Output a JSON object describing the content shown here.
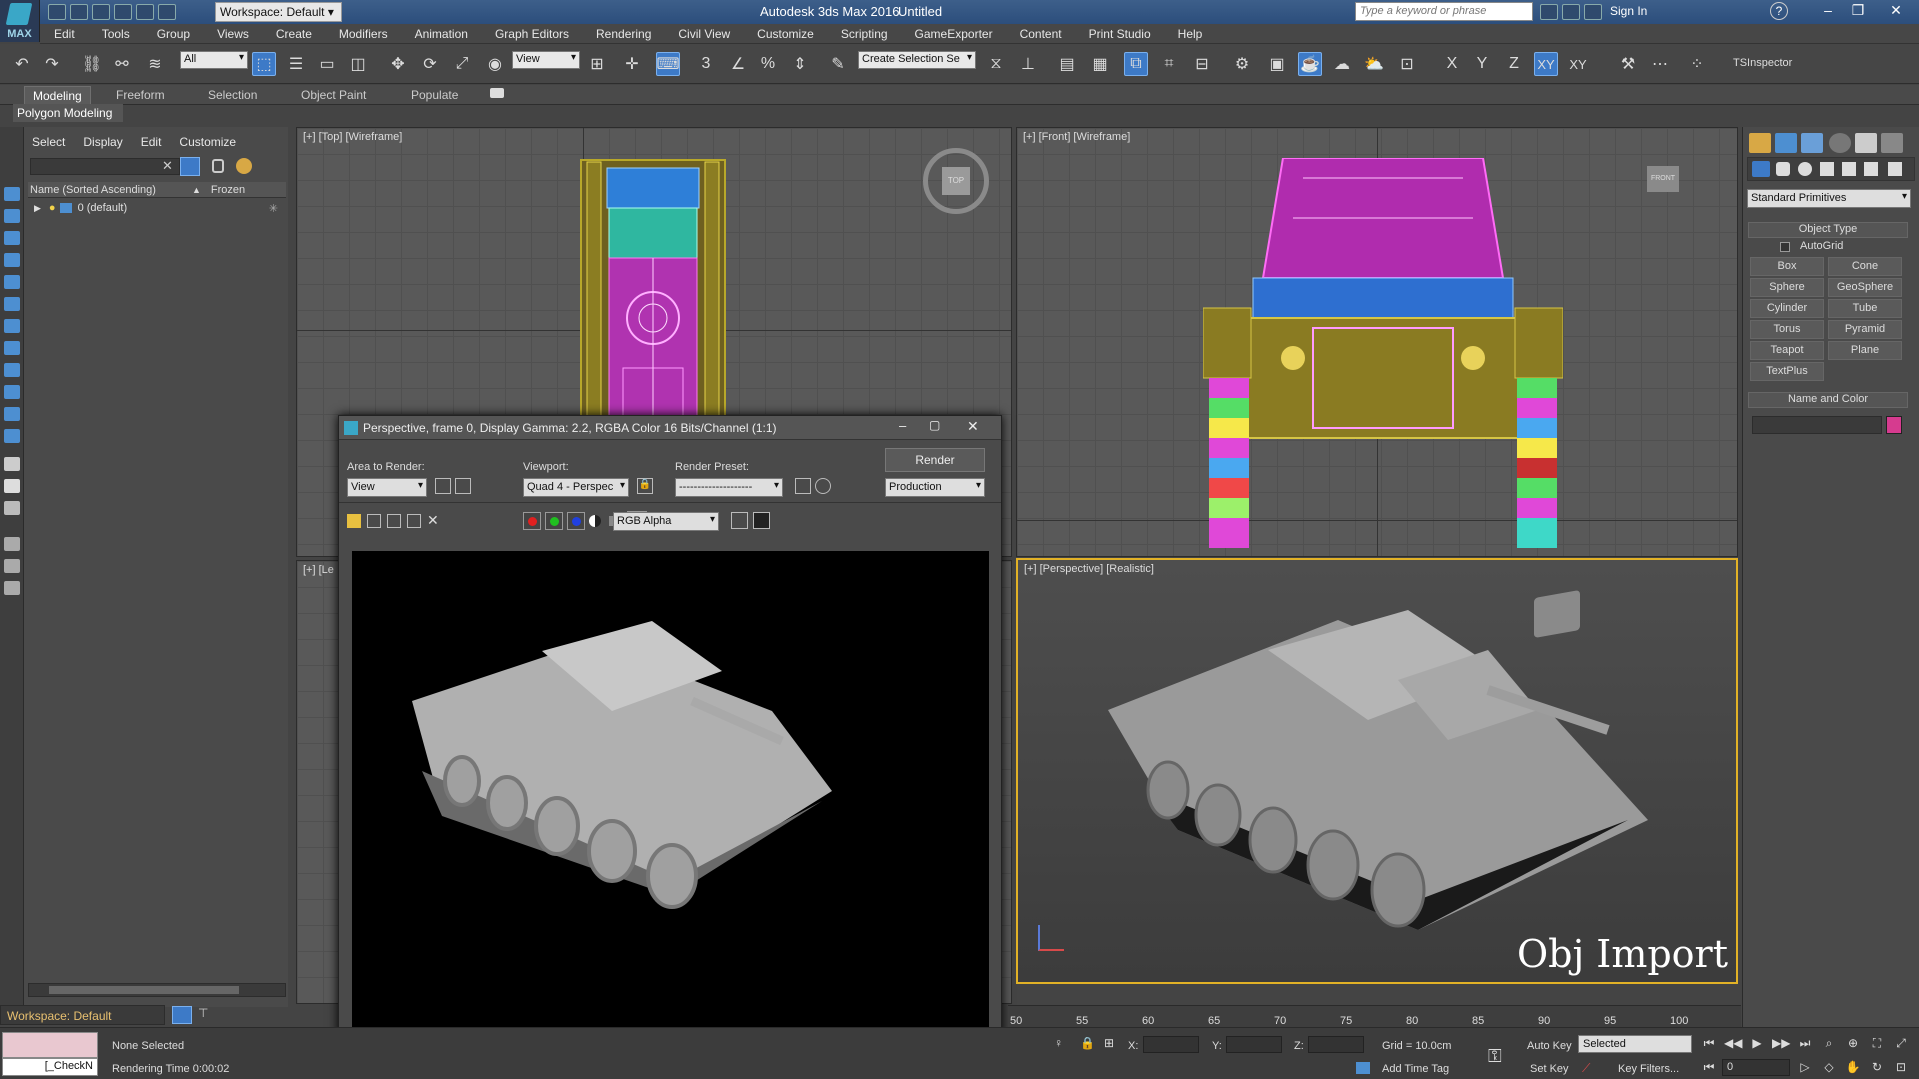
{
  "titlebar": {
    "app_title": "Autodesk 3ds Max 2016",
    "document": "Untitled",
    "workspace": "Workspace: Default",
    "search_placeholder": "Type a keyword or phrase",
    "sign_in": "Sign In",
    "logo_text": "MAX"
  },
  "menu": [
    "Edit",
    "Tools",
    "Group",
    "Views",
    "Create",
    "Modifiers",
    "Animation",
    "Graph Editors",
    "Rendering",
    "Civil View",
    "Customize",
    "Scripting",
    "GameExporter",
    "Content",
    "Print Studio",
    "Help"
  ],
  "toolbar": {
    "selection_filter": "All",
    "reference_coord": "View",
    "named_selection": "Create Selection Se",
    "snap_label": "3",
    "inspector": "TSInspector",
    "axes": [
      "X",
      "Y",
      "Z",
      "XY",
      "XY"
    ]
  },
  "ribbon": {
    "tabs": [
      "Modeling",
      "Freeform",
      "Selection",
      "Object Paint",
      "Populate"
    ],
    "active_tab": "Modeling",
    "panel": "Polygon Modeling"
  },
  "scene_explorer": {
    "menu": [
      "Select",
      "Display",
      "Edit",
      "Customize"
    ],
    "col_name": "Name (Sorted Ascending)",
    "col_sort": "▲",
    "col_frozen": "Frozen",
    "layer_row": "0 (default)"
  },
  "viewports": {
    "top": "[+] [Top] [Wireframe]",
    "front": "[+] [Front] [Wireframe]",
    "left": "[+] [Le",
    "perspective": "[+] [Perspective] [Realistic]",
    "overlay_text": "Obj Import",
    "viewcube_top": "TOP",
    "viewcube_front": "FRONT"
  },
  "render_frame": {
    "title": "Perspective, frame 0, Display Gamma: 2.2, RGBA Color 16 Bits/Channel (1:1)",
    "area_label": "Area to Render:",
    "area_value": "View",
    "viewport_label": "Viewport:",
    "viewport_value": "Quad 4 - Perspec",
    "preset_label": "Render Preset:",
    "preset_value": "--------------------",
    "render_button": "Render",
    "mode_value": "Production",
    "channel_value": "RGB Alpha"
  },
  "command_panel": {
    "category": "Standard Primitives",
    "object_type": "Object Type",
    "autogrid": "AutoGrid",
    "buttons": [
      "Box",
      "Cone",
      "Sphere",
      "GeoSphere",
      "Cylinder",
      "Tube",
      "Torus",
      "Pyramid",
      "Teapot",
      "Plane",
      "TextPlus"
    ],
    "name_and_color": "Name and Color",
    "object_color": "#d63b8f"
  },
  "timeline": {
    "ticks": [
      "50",
      "55",
      "60",
      "65",
      "70",
      "75",
      "80",
      "85",
      "90",
      "95",
      "100"
    ]
  },
  "status": {
    "workspace": "Workspace: Default",
    "maxscript": "[_CheckN",
    "selection": "None Selected",
    "render_time": "Rendering Time  0:00:02",
    "x_label": "X:",
    "y_label": "Y:",
    "z_label": "Z:",
    "grid": "Grid = 10.0cm",
    "add_time_tag": "Add Time Tag",
    "auto_key": "Auto Key",
    "set_key": "Set Key",
    "selected": "Selected",
    "key_filters": "Key Filters...",
    "frame": "0"
  },
  "colors": {
    "accent": "#3d7ac7",
    "active_viewport": "#e2b227",
    "wire_magenta": "#e040d8",
    "wire_olive": "#9a8a1c"
  }
}
